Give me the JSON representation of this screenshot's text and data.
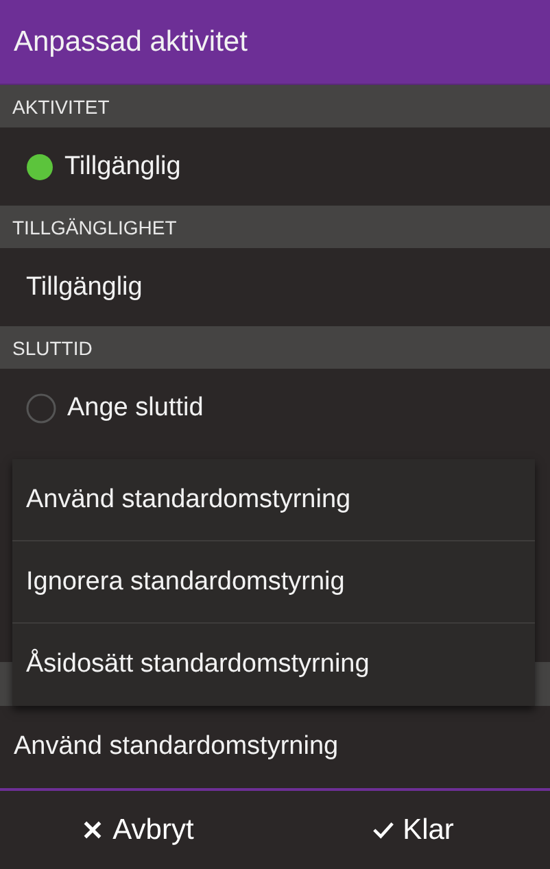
{
  "window": {
    "title": "Anpassad aktivitet"
  },
  "sections": [
    {
      "header": "AKTIVITET",
      "kind": "status",
      "value": "Tillgänglig"
    },
    {
      "header": "TILLGÄNGLIGHET",
      "kind": "text",
      "value": "Tillgänglig"
    },
    {
      "header": "SLUTTID",
      "kind": "radio",
      "value": "Ange sluttid",
      "checked": false
    }
  ],
  "override": {
    "value": "Använd standardomstyrning"
  },
  "dropdown": {
    "options": [
      "Använd standardomstyrning",
      "Ignorera standardomstyrnig",
      "Åsidosätt standardomstyrning"
    ]
  },
  "buttons": [
    {
      "label": "Avbryt",
      "kind": "cancel"
    },
    {
      "label": "Klar",
      "kind": "done"
    }
  ]
}
